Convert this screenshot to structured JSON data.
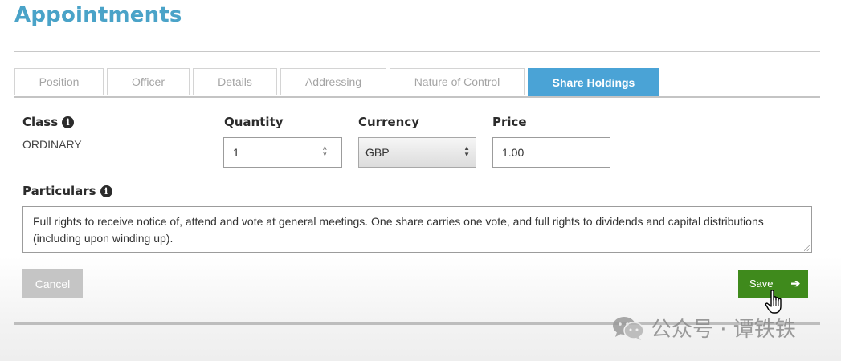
{
  "page": {
    "title": "Appointments"
  },
  "tabs": [
    {
      "label": "Position"
    },
    {
      "label": "Officer"
    },
    {
      "label": "Details"
    },
    {
      "label": "Addressing"
    },
    {
      "label": "Nature of Control"
    },
    {
      "label": "Share Holdings",
      "active": true
    }
  ],
  "form": {
    "class": {
      "label": "Class",
      "value": "ORDINARY"
    },
    "quantity": {
      "label": "Quantity",
      "value": "1"
    },
    "currency": {
      "label": "Currency",
      "selected": "GBP"
    },
    "price": {
      "label": "Price",
      "value": "1.00"
    },
    "particulars": {
      "label": "Particulars",
      "value": "Full rights to receive notice of, attend and vote at general meetings. One share carries one vote, and full rights to dividends and capital distributions (including upon winding up)."
    }
  },
  "actions": {
    "cancel_label": "Cancel",
    "save_label": "Save"
  },
  "watermark": {
    "text": "公众号 · 谭铁铁"
  },
  "colors": {
    "title": "#4aa3c8",
    "active_tab": "#4aa3d6",
    "save_button": "#3f8a1c",
    "cancel_button": "#c5c5c5"
  }
}
